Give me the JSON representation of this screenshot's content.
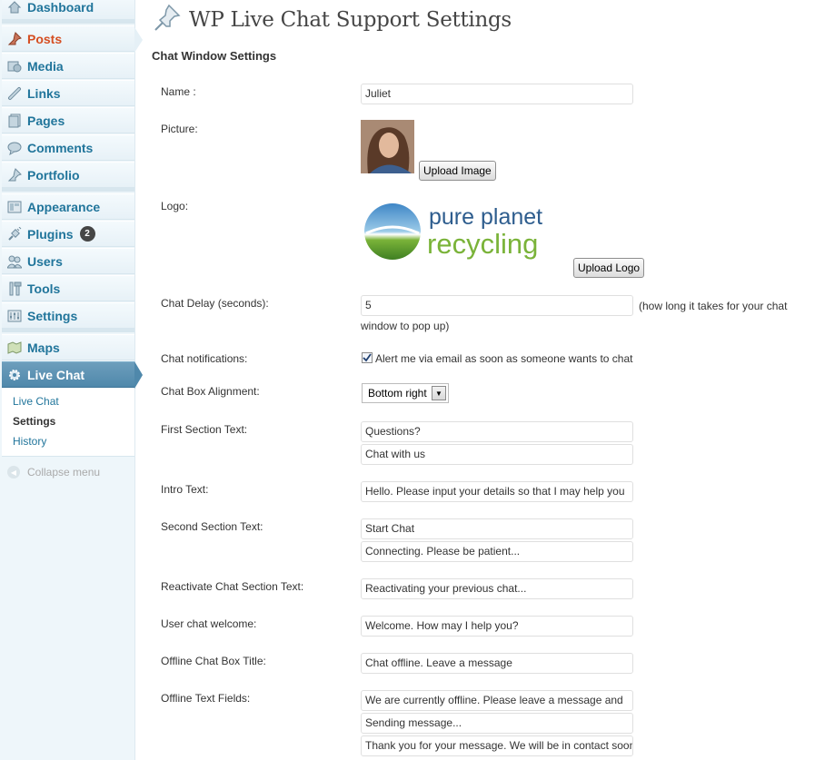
{
  "sidebar": {
    "items": [
      {
        "label": "Dashboard",
        "icon": "home-icon"
      },
      {
        "label": "Posts",
        "icon": "pushpin-icon"
      },
      {
        "label": "Media",
        "icon": "media-icon"
      },
      {
        "label": "Links",
        "icon": "link-icon"
      },
      {
        "label": "Pages",
        "icon": "pages-icon"
      },
      {
        "label": "Comments",
        "icon": "comment-icon"
      },
      {
        "label": "Portfolio",
        "icon": "pushpin-icon"
      },
      {
        "label": "Appearance",
        "icon": "appearance-icon"
      },
      {
        "label": "Plugins",
        "icon": "plug-icon",
        "badge": "2"
      },
      {
        "label": "Users",
        "icon": "users-icon"
      },
      {
        "label": "Tools",
        "icon": "tools-icon"
      },
      {
        "label": "Settings",
        "icon": "settings-icon"
      },
      {
        "label": "Maps",
        "icon": "map-icon"
      },
      {
        "label": "Live Chat",
        "icon": "gear-icon"
      }
    ],
    "submenu": [
      "Live Chat",
      "Settings",
      "History"
    ],
    "collapse": "Collapse menu"
  },
  "page": {
    "title": "WP Live Chat Support Settings",
    "section": "Chat Window Settings"
  },
  "form": {
    "name_label": "Name :",
    "name_value": "Juliet",
    "picture_label": "Picture:",
    "upload_image": "Upload Image",
    "logo_label": "Logo:",
    "logo_text_1": "pure planet",
    "logo_text_2": "recycling",
    "upload_logo": "Upload Logo",
    "delay_label": "Chat Delay (seconds):",
    "delay_value": "5",
    "delay_note_1": "(how long it takes for your chat",
    "delay_note_2": "window to pop up)",
    "notif_label": "Chat notifications:",
    "notif_text": "Alert me via email as soon as someone wants to chat",
    "notif_checked": true,
    "align_label": "Chat Box Alignment:",
    "align_value": "Bottom right",
    "first_label": "First Section Text:",
    "first_value_1": "Questions?",
    "first_value_2": "Chat with us",
    "intro_label": "Intro Text:",
    "intro_value": "Hello. Please input your details so that I may help you",
    "second_label": "Second Section Text:",
    "second_value_1": "Start Chat",
    "second_value_2": "Connecting. Please be patient...",
    "reactivate_label": "Reactivate Chat Section Text:",
    "reactivate_value": "Reactivating your previous chat...",
    "welcome_label": "User chat welcome:",
    "welcome_value": "Welcome. How may I help you?",
    "offline_title_label": "Offline Chat Box Title:",
    "offline_title_value": "Chat offline. Leave a message",
    "offline_fields_label": "Offline Text Fields:",
    "offline_value_1": "We are currently offline. Please leave a message and",
    "offline_value_2": "Sending message...",
    "offline_value_3": "Thank you for your message. We will be in contact soon"
  },
  "colors": {
    "link": "#21759b",
    "active_posts": "#d54e21",
    "live_chat_bg": "#4f88ab",
    "logo_blue": "#2e5d8e",
    "logo_green": "#7ab339"
  }
}
